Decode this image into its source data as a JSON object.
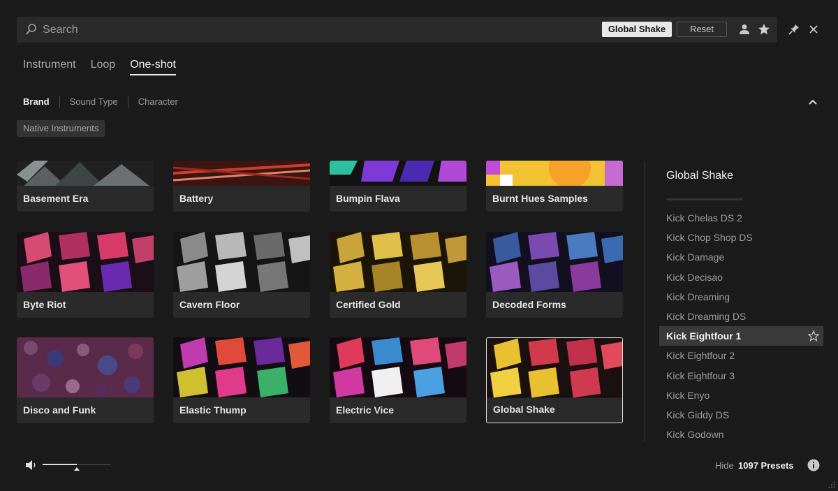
{
  "search": {
    "placeholder": "Search"
  },
  "active_filter": "Global Shake",
  "reset_label": "Reset",
  "tabs": [
    {
      "label": "Instrument"
    },
    {
      "label": "Loop"
    },
    {
      "label": "One-shot",
      "active": true
    }
  ],
  "filters": [
    {
      "label": "Brand"
    },
    {
      "label": "Sound Type"
    },
    {
      "label": "Character"
    }
  ],
  "selected_tag": "Native Instruments",
  "products": [
    {
      "name": "Basement Era"
    },
    {
      "name": "Battery"
    },
    {
      "name": "Bumpin Flava"
    },
    {
      "name": "Burnt Hues Samples"
    },
    {
      "name": "Byte Riot"
    },
    {
      "name": "Cavern Floor"
    },
    {
      "name": "Certified Gold"
    },
    {
      "name": "Decoded Forms"
    },
    {
      "name": "Disco and Funk"
    },
    {
      "name": "Elastic Thump"
    },
    {
      "name": "Electric Vice"
    },
    {
      "name": "Global Shake",
      "selected": true
    }
  ],
  "side_panel": {
    "title": "Global Shake",
    "presets": [
      {
        "name": "Kick Chelas DS 2"
      },
      {
        "name": "Kick Chop Shop DS"
      },
      {
        "name": "Kick Damage"
      },
      {
        "name": "Kick Decisao"
      },
      {
        "name": "Kick Dreaming"
      },
      {
        "name": "Kick Dreaming DS"
      },
      {
        "name": "Kick Eightfour 1",
        "selected": true
      },
      {
        "name": "Kick Eightfour 2"
      },
      {
        "name": "Kick Eightfour 3"
      },
      {
        "name": "Kick Enyo"
      },
      {
        "name": "Kick Giddy DS"
      },
      {
        "name": "Kick Godown"
      }
    ]
  },
  "footer": {
    "hide_label": "Hide",
    "preset_count": "1097 Presets"
  },
  "volume": {
    "level": 0.5
  },
  "colors": {
    "background": "#1b1b1b",
    "panel": "#2a2a2a",
    "text": "#bdbdbd",
    "highlight": "#f0f0f0"
  }
}
